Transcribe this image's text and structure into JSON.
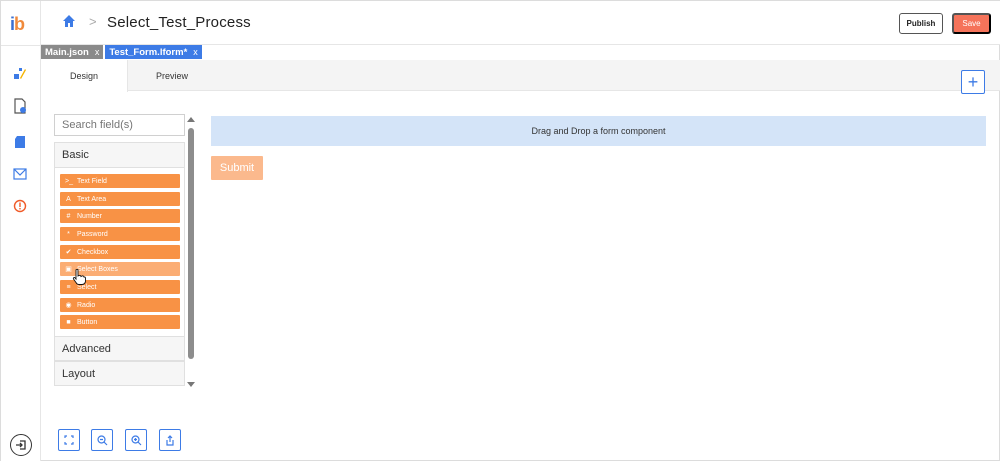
{
  "app": {
    "logo_text": "ib"
  },
  "header": {
    "title": "Select_Test_Process",
    "separator": ">",
    "publish_label": "Publish",
    "save_label": "Save"
  },
  "file_tabs": [
    {
      "label": "Main.json",
      "close": "x"
    },
    {
      "label": "Test_Form.lform*",
      "close": "x"
    }
  ],
  "view_tabs": {
    "design": "Design",
    "preview": "Preview",
    "add": "+"
  },
  "palette": {
    "search_placeholder": "Search field(s)",
    "groups": {
      "basic": "Basic",
      "advanced": "Advanced",
      "layout": "Layout"
    },
    "components": [
      {
        "icon": ">_",
        "label": "Text Field"
      },
      {
        "icon": "A",
        "label": "Text Area"
      },
      {
        "icon": "#",
        "label": "Number"
      },
      {
        "icon": "*",
        "label": "Password"
      },
      {
        "icon": "✔",
        "label": "Checkbox"
      },
      {
        "icon": "▣",
        "label": "Select Boxes"
      },
      {
        "icon": "≡",
        "label": "Select"
      },
      {
        "icon": "◉",
        "label": "Radio"
      },
      {
        "icon": "■",
        "label": "Button"
      }
    ]
  },
  "canvas": {
    "dropzone_text": "Drag and Drop a form component",
    "submit_label": "Submit"
  },
  "colors": {
    "accent": "#3d7be6",
    "component": "#f89245",
    "save": "#f5735a",
    "dropzone": "#d4e4f8"
  }
}
